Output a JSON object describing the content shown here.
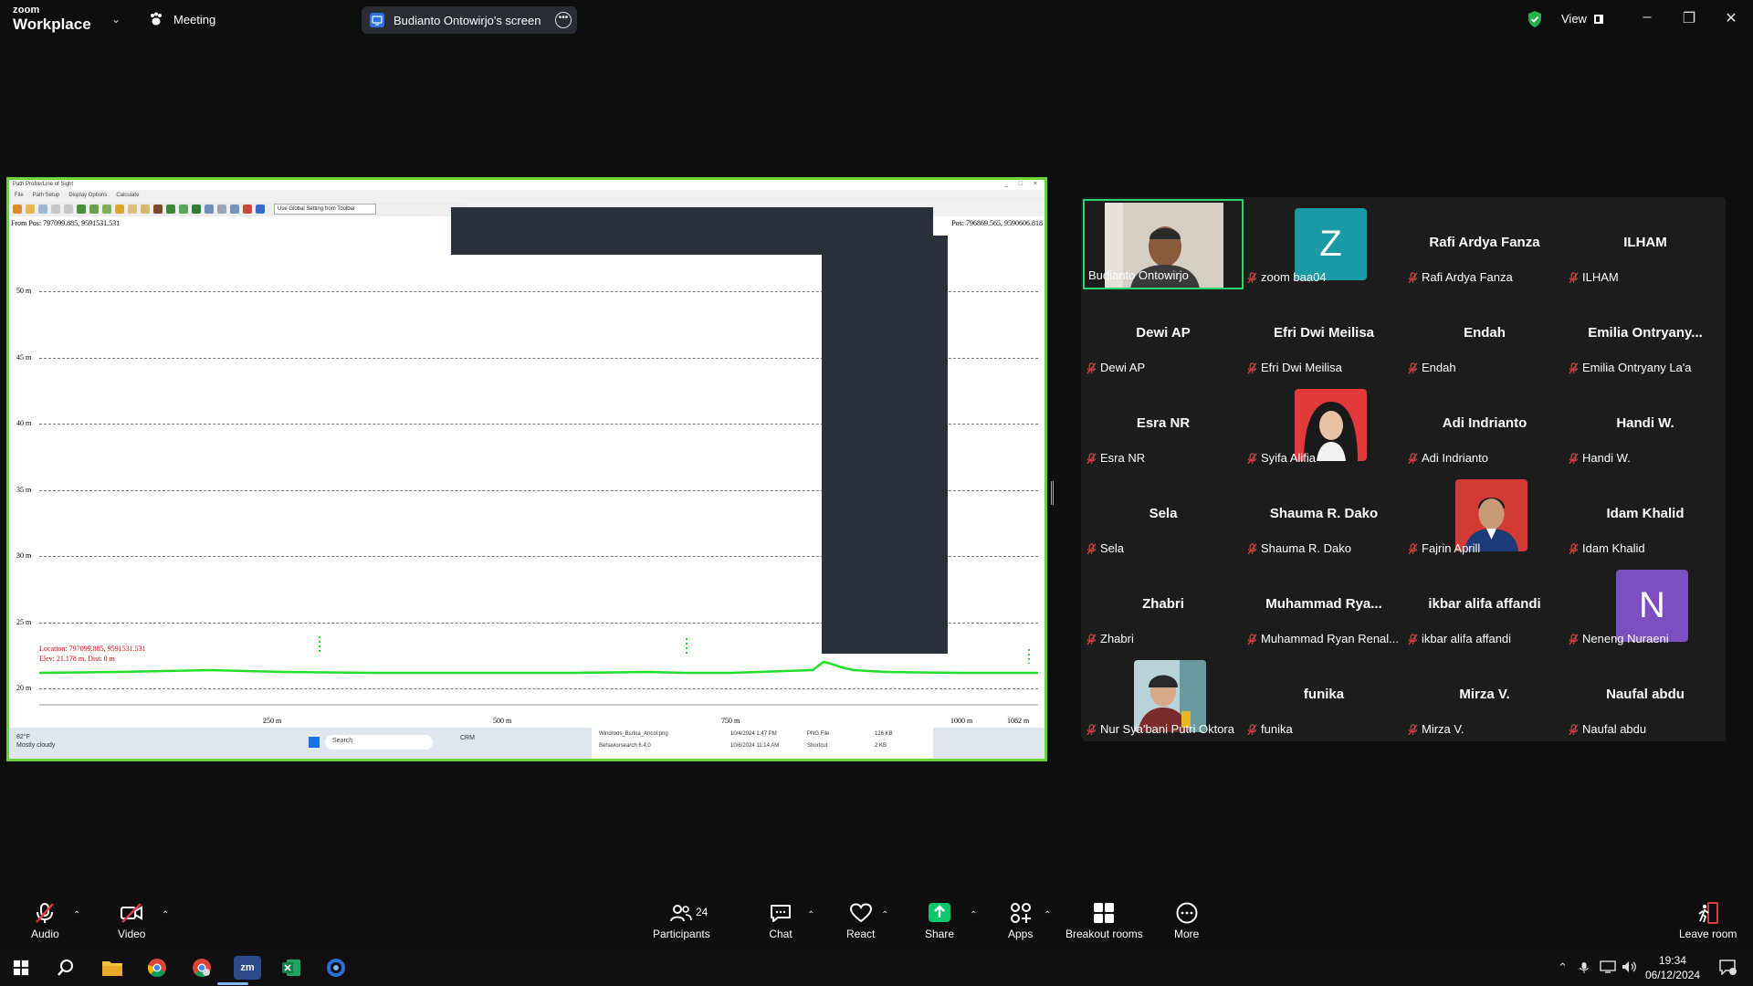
{
  "titlebar": {
    "brand_top": "zoom",
    "brand_bottom": "Workplace",
    "meeting_label": "Meeting",
    "screen_share_label": "Budianto Ontowirjo's screen",
    "view_label": "View"
  },
  "shared_screen": {
    "window_title": "Path Profile/Line of Sight",
    "menu": [
      "File",
      "Path Setup",
      "Display Options",
      "Calculate"
    ],
    "toolbar_select": "Use Global Setting from Toolbar",
    "from_pos": "From Pos: 797099.885, 9591531.531",
    "to_pos": "Pos: 796869.565, 9590606.818",
    "y_labels": [
      "50 m",
      "45 m",
      "40 m",
      "35 m",
      "30 m",
      "25 m",
      "20 m"
    ],
    "x_labels": [
      "250 m",
      "500 m",
      "750 m",
      "1000 m",
      "1082 m"
    ],
    "location_line1": "Location: 797099.885, 9591531.531",
    "location_line2": "Elev: 21.178 m, Dist: 0 m",
    "taskbar": {
      "temp": "82°F",
      "weather": "Mostly cloudy",
      "search": "Search",
      "folder": "CRM",
      "files": [
        {
          "name": "Windroos_Bsrina_Ancol.png",
          "date": "10/4/2024 1:47 PM",
          "type": "PNG File",
          "size": "126 KB"
        },
        {
          "name": "Behaviorsearch 6.4.0",
          "date": "10/6/2024 11:14 AM",
          "type": "Shortcut",
          "size": "2 KB"
        }
      ]
    }
  },
  "gallery": {
    "tiles": [
      {
        "big": "",
        "label": "Budianto Ontowirjo",
        "type": "video",
        "muted": false,
        "active": true
      },
      {
        "big": "",
        "label": "zoom baa04",
        "type": "letter",
        "letter": "Z",
        "color": "#1a9aa5",
        "muted": true
      },
      {
        "big": "Rafi Ardya Fanza",
        "label": "Rafi Ardya Fanza",
        "type": "name",
        "muted": true
      },
      {
        "big": "ILHAM",
        "label": "ILHAM",
        "type": "name",
        "muted": true
      },
      {
        "big": "Dewi AP",
        "label": "Dewi AP",
        "type": "name",
        "muted": true
      },
      {
        "big": "Efri Dwi Meilisa",
        "label": "Efri Dwi Meilisa",
        "type": "name",
        "muted": true
      },
      {
        "big": "Endah",
        "label": "Endah",
        "type": "name",
        "muted": true
      },
      {
        "big": "Emilia  Ontryany...",
        "label": "Emilia Ontryany La'a",
        "type": "name",
        "muted": true
      },
      {
        "big": "Esra NR",
        "label": "Esra NR",
        "type": "name",
        "muted": true
      },
      {
        "big": "",
        "label": "Syifa Alifia",
        "type": "photo",
        "photo": "hijab",
        "muted": true
      },
      {
        "big": "Adi Indrianto",
        "label": "Adi Indrianto",
        "type": "name",
        "muted": true
      },
      {
        "big": "Handi W.",
        "label": "Handi W.",
        "type": "name",
        "muted": true
      },
      {
        "big": "Sela",
        "label": "Sela",
        "type": "name",
        "muted": true
      },
      {
        "big": "Shauma R. Dako",
        "label": "Shauma R. Dako",
        "type": "name",
        "muted": true
      },
      {
        "big": "",
        "label": "Fajrin Aprill",
        "type": "photo",
        "photo": "man",
        "muted": true
      },
      {
        "big": "Idam Khalid",
        "label": "Idam Khalid",
        "type": "name",
        "muted": true
      },
      {
        "big": "Zhabri",
        "label": "Zhabri",
        "type": "name",
        "muted": true
      },
      {
        "big": "Muhammad  Rya...",
        "label": "Muhammad Ryan Renal...",
        "type": "name",
        "muted": true
      },
      {
        "big": "ikbar alifa affandi",
        "label": "ikbar alifa affandi",
        "type": "name",
        "muted": true
      },
      {
        "big": "",
        "label": "Neneng Nuraeni",
        "type": "letter",
        "letter": "N",
        "color": "#7b4fc0",
        "muted": true
      },
      {
        "big": "",
        "label": "Nur Sya'bani Putri Oktora",
        "type": "photo",
        "photo": "woman",
        "muted": true
      },
      {
        "big": "funika",
        "label": "funika",
        "type": "name",
        "muted": true
      },
      {
        "big": "Mirza V.",
        "label": "Mirza V.",
        "type": "name",
        "muted": true
      },
      {
        "big": "Naufal abdu",
        "label": "Naufal abdu",
        "type": "name",
        "muted": true
      }
    ]
  },
  "toolbar": {
    "audio": "Audio",
    "video": "Video",
    "participants": "Participants",
    "participants_count": "24",
    "chat": "Chat",
    "react": "React",
    "share": "Share",
    "apps": "Apps",
    "breakout": "Breakout rooms",
    "more": "More",
    "leave": "Leave room"
  },
  "taskbar": {
    "time": "19:34",
    "date": "06/12/2024"
  },
  "colors": {
    "accent_green": "#2dd36f",
    "share_green": "#0ec66b",
    "mute_red": "#e0393e",
    "screen_border": "#6ad23a"
  }
}
